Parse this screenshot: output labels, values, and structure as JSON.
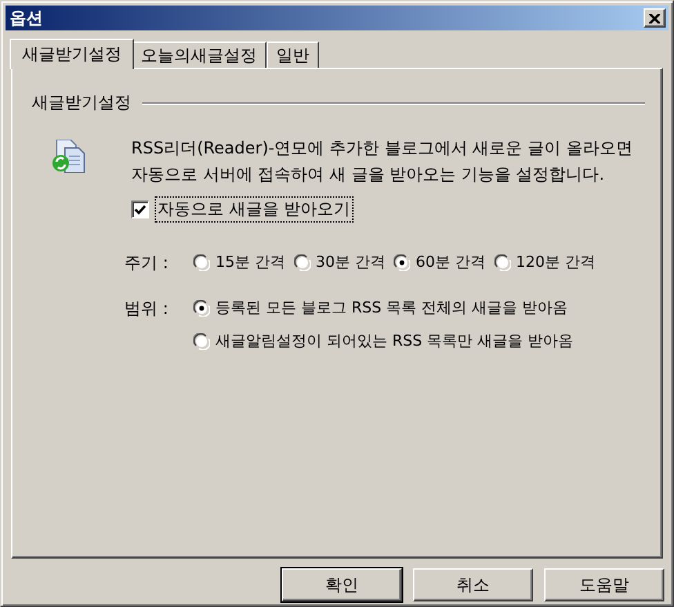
{
  "window": {
    "title": "옵션"
  },
  "tabs": [
    {
      "label": "새글받기설정",
      "selected": true
    },
    {
      "label": "오늘의새글설정",
      "selected": false
    },
    {
      "label": "일반",
      "selected": false
    }
  ],
  "group": {
    "title": "새글받기설정",
    "description": "RSS리더(Reader)-연모에 추가한 블로그에서 새로운 글이 올라오면\n자동으로 서버에 접속하여 새 글을 받아오는 기능을 설정합니다.",
    "auto_receive": {
      "label": "자동으로 새글을 받아오기",
      "checked": true,
      "focused": true
    },
    "interval": {
      "label": "주기 :",
      "options": [
        {
          "label": "15분 간격",
          "selected": false
        },
        {
          "label": "30분 간격",
          "selected": false
        },
        {
          "label": "60분 간격",
          "selected": true
        },
        {
          "label": "120분 간격",
          "selected": false
        }
      ]
    },
    "scope": {
      "label": "범위 :",
      "options": [
        {
          "label": "등록된 모든 블로그 RSS 목록 전체의 새글을 받아옴",
          "selected": true
        },
        {
          "label": "새글알림설정이 되어있는 RSS 목록만 새글을 받아옴",
          "selected": false
        }
      ]
    }
  },
  "buttons": [
    {
      "label": "확인",
      "default": true
    },
    {
      "label": "취소",
      "default": false
    },
    {
      "label": "도움말",
      "default": false
    }
  ]
}
